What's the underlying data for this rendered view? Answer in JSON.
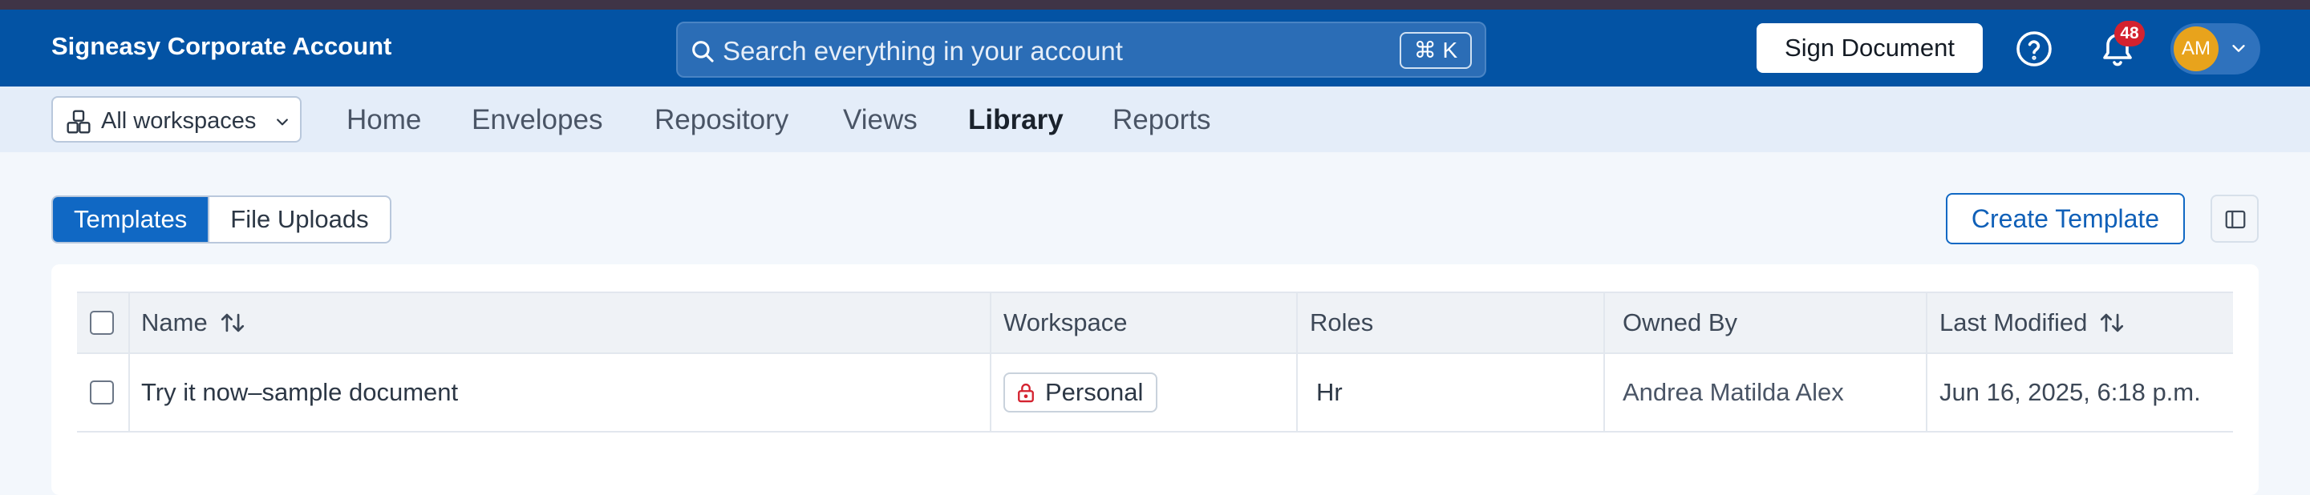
{
  "header": {
    "brand": "Signeasy Corporate Account",
    "search_placeholder": "Search everything in your account",
    "search_shortcut": "⌘ K",
    "sign_button": "Sign Document",
    "notification_count": "48",
    "avatar_initials": "AM",
    "colors": {
      "topbar": "#0353a4",
      "badge": "#d4222f",
      "avatar": "#e8a31c"
    }
  },
  "subnav": {
    "workspace_select": "All workspaces",
    "items": [
      {
        "label": "Home",
        "active": false
      },
      {
        "label": "Envelopes",
        "active": false
      },
      {
        "label": "Repository",
        "active": false
      },
      {
        "label": "Views",
        "active": false
      },
      {
        "label": "Library",
        "active": true
      },
      {
        "label": "Reports",
        "active": false
      }
    ]
  },
  "toolbar": {
    "tabs": [
      {
        "label": "Templates",
        "selected": true
      },
      {
        "label": "File Uploads",
        "selected": false
      }
    ],
    "create_button": "Create Template"
  },
  "table": {
    "columns": [
      {
        "label": "Name",
        "sortable": true
      },
      {
        "label": "Workspace",
        "sortable": false
      },
      {
        "label": "Roles",
        "sortable": false
      },
      {
        "label": "Owned By",
        "sortable": false
      },
      {
        "label": "Last Modified",
        "sortable": true
      }
    ],
    "rows": [
      {
        "name": "Try it now–sample document",
        "workspace": "Personal",
        "workspace_icon": "lock-icon",
        "roles": "Hr",
        "owned_by": "Andrea Matilda Alex",
        "last_modified": "Jun 16, 2025, 6:18 p.m."
      }
    ]
  }
}
